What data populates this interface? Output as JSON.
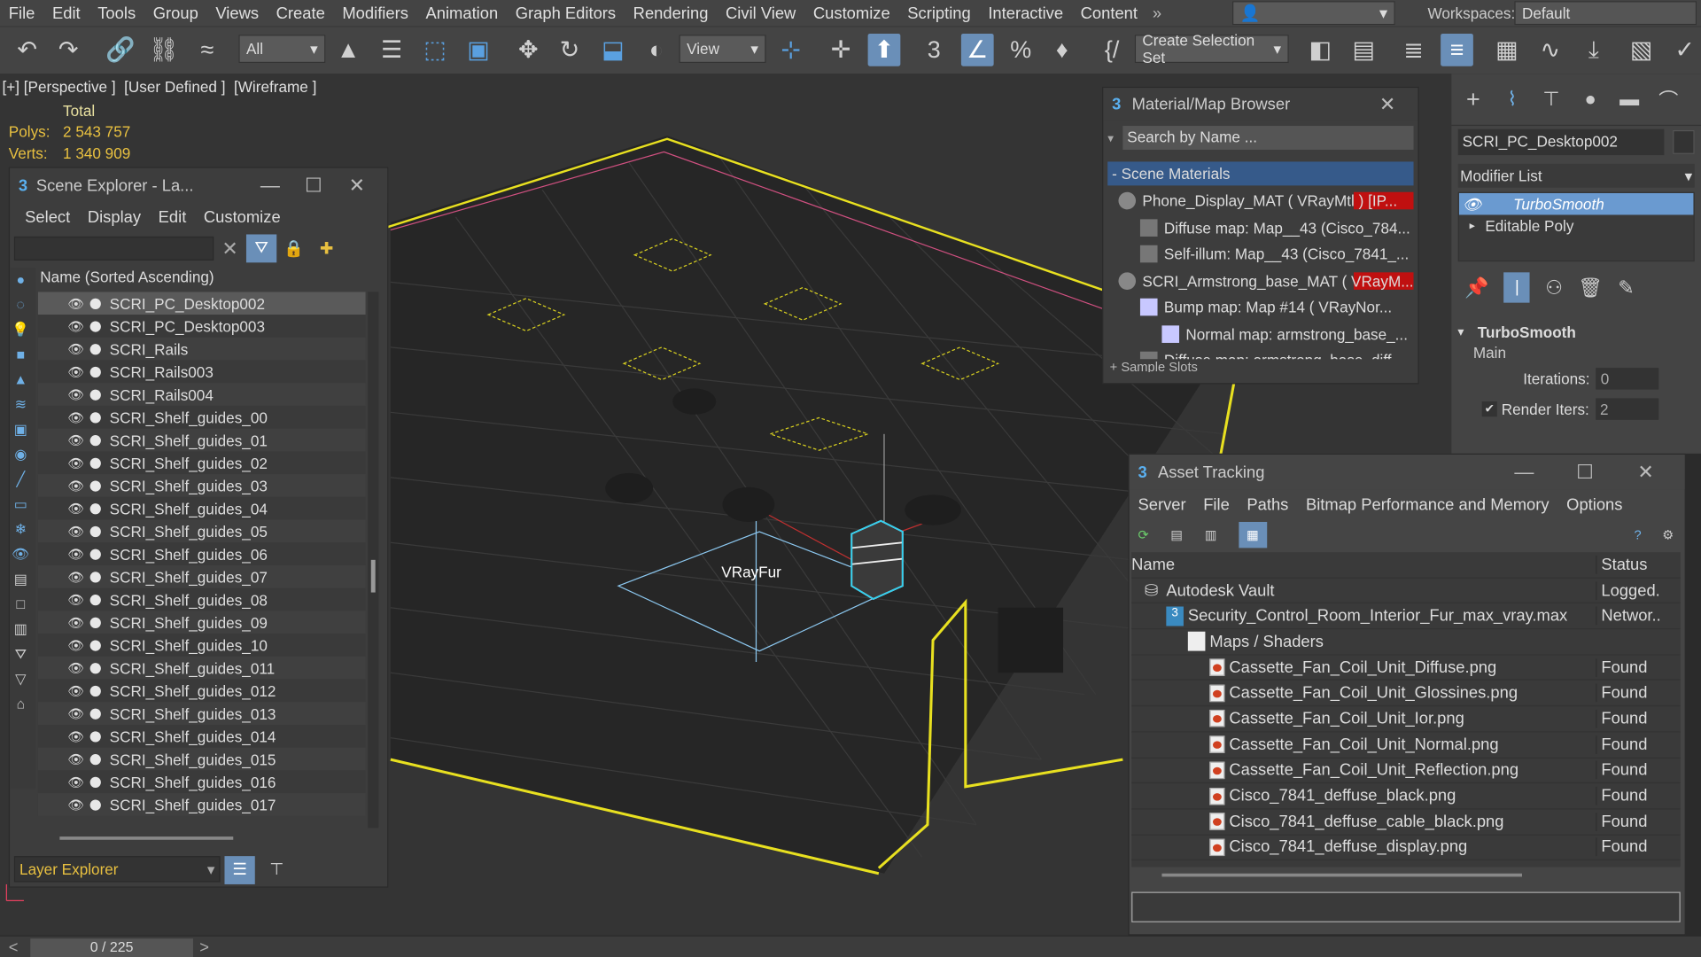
{
  "menu": [
    "File",
    "Edit",
    "Tools",
    "Group",
    "Views",
    "Create",
    "Modifiers",
    "Animation",
    "Graph Editors",
    "Rendering",
    "Civil View",
    "Customize",
    "Scripting",
    "Interactive",
    "Content"
  ],
  "menu_more": "»",
  "workspaces": {
    "label": "Workspaces:",
    "value": "Default"
  },
  "toolbar": {
    "filter": "All",
    "ref_coord": "View",
    "selection_set": "Create Selection Set"
  },
  "viewport": {
    "label": "[+] [Perspective ]  [User Defined ]  [Wireframe ]",
    "total_label": "Total",
    "polys_label": "Polys:",
    "polys": "2 543 757",
    "verts_label": "Verts:",
    "verts": "1 340 909",
    "object_label": "VRayFur"
  },
  "scene_explorer": {
    "title": "Scene Explorer - La...",
    "menus": [
      "Select",
      "Display",
      "Edit",
      "Customize"
    ],
    "column": "Name (Sorted Ascending)",
    "items": [
      "SCRI_PC_Desktop002",
      "SCRI_PC_Desktop003",
      "SCRI_Rails",
      "SCRI_Rails003",
      "SCRI_Rails004",
      "SCRI_Shelf_guides_00",
      "SCRI_Shelf_guides_01",
      "SCRI_Shelf_guides_02",
      "SCRI_Shelf_guides_03",
      "SCRI_Shelf_guides_04",
      "SCRI_Shelf_guides_05",
      "SCRI_Shelf_guides_06",
      "SCRI_Shelf_guides_07",
      "SCRI_Shelf_guides_08",
      "SCRI_Shelf_guides_09",
      "SCRI_Shelf_guides_10",
      "SCRI_Shelf_guides_011",
      "SCRI_Shelf_guides_012",
      "SCRI_Shelf_guides_013",
      "SCRI_Shelf_guides_014",
      "SCRI_Shelf_guides_015",
      "SCRI_Shelf_guides_016",
      "SCRI_Shelf_guides_017"
    ],
    "footer": "Layer Explorer"
  },
  "material_browser": {
    "title": "Material/Map Browser",
    "search_placeholder": "Search by Name ...",
    "section": "- Scene Materials",
    "items": [
      "Phone_Display_MAT  ( VRayMtl )  [IP...",
      "Diffuse map: Map__43 (Cisco_784...",
      "Self-illum: Map__43 (Cisco_7841_...",
      "SCRI_Armstrong_base_MAT  ( VRayM...",
      "Bump map: Map #14  ( VRayNor...",
      "Normal map: armstrong_base_...",
      "Diffuse map: armstrong_base_diff..."
    ],
    "sample_slots": "+ Sample Slots"
  },
  "command_panel": {
    "object_name": "SCRI_PC_Desktop002",
    "modifier_list": "Modifier List",
    "stack": [
      "TurboSmooth",
      "Editable Poly"
    ],
    "rollout": "TurboSmooth",
    "main": "Main",
    "iterations_label": "Iterations:",
    "iterations": "0",
    "render_iters_label": "Render Iters:",
    "render_iters": "2"
  },
  "asset_tracking": {
    "title": "Asset Tracking",
    "menus": [
      "Server",
      "File",
      "Paths",
      "Bitmap Performance and Memory",
      "Options"
    ],
    "col_name": "Name",
    "col_status": "Status",
    "rows": [
      {
        "name": "Autodesk Vault",
        "status": "Logged.",
        "indent": 0
      },
      {
        "name": "Security_Control_Room_Interior_Fur_max_vray.max",
        "status": "Networ..",
        "indent": 1
      },
      {
        "name": "Maps / Shaders",
        "status": "",
        "indent": 2
      },
      {
        "name": "Cassette_Fan_Coil_Unit_Diffuse.png",
        "status": "Found",
        "indent": 3
      },
      {
        "name": "Cassette_Fan_Coil_Unit_Glossines.png",
        "status": "Found",
        "indent": 3
      },
      {
        "name": "Cassette_Fan_Coil_Unit_Ior.png",
        "status": "Found",
        "indent": 3
      },
      {
        "name": "Cassette_Fan_Coil_Unit_Normal.png",
        "status": "Found",
        "indent": 3
      },
      {
        "name": "Cassette_Fan_Coil_Unit_Reflection.png",
        "status": "Found",
        "indent": 3
      },
      {
        "name": "Cisco_7841_deffuse_black.png",
        "status": "Found",
        "indent": 3
      },
      {
        "name": "Cisco_7841_deffuse_cable_black.png",
        "status": "Found",
        "indent": 3
      },
      {
        "name": "Cisco_7841_deffuse_display.png",
        "status": "Found",
        "indent": 3
      }
    ]
  },
  "timeline": {
    "frame": "0 / 225"
  }
}
